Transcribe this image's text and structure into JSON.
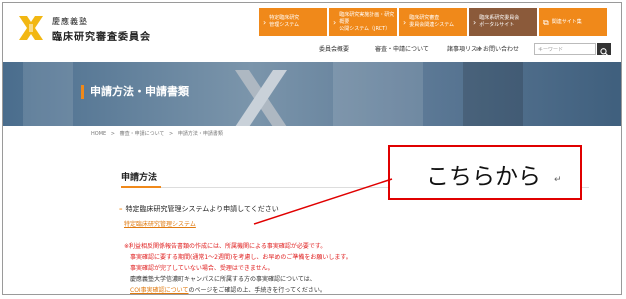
{
  "header": {
    "logo_line1": "慶應義塾",
    "logo_line2": "臨床研究審査委員会"
  },
  "topnav": [
    {
      "line1": "特定臨床研究",
      "line2": "管理システム",
      "style": "orange"
    },
    {
      "line1": "臨床研究実施計画・研究概要",
      "line2": "公開システム（jRCT）",
      "style": "orange"
    },
    {
      "line1": "臨床研究審査",
      "line2": "委員会関連システム",
      "style": "orange"
    },
    {
      "line1": "臨床系研究委員会",
      "line2": "ポータルサイト",
      "style": "brown"
    },
    {
      "line1": "関連サイト集",
      "line2": "",
      "style": "orange"
    }
  ],
  "subnav": {
    "overview": "委員会概要",
    "review": "審査・申請について",
    "checklist": "諸事項リスト",
    "contact": "お問い合わせ"
  },
  "search": {
    "placeholder": "キーワード"
  },
  "banner": {
    "title": "申請方法・申請書類"
  },
  "breadcrumb": [
    "HOME",
    "審査・申請について",
    "申請方法・申請書類"
  ],
  "breadcrumb_sep": ">",
  "content": {
    "heading": "申請方法",
    "subheading": "特定臨床研究管理システムより申請してください",
    "system_link": "特定臨床研究管理システム",
    "notes": {
      "line1": "※利益相反関係報告書類の作成には、所属機関による事実確認が必要です。",
      "line2": "事実確認に要する期間(通常1～2週間)を考慮し、お早めのご準備をお願いします。",
      "line3": "事実確認が完了していない場合、受理はできません。",
      "line4": "慶應義塾大学信濃町キャンパスに所属する方の事実確認については、",
      "line5_link": "COI事実確認について",
      "line5_rest": "のページをご確認の上、手続きを行ってください。"
    }
  },
  "callout": {
    "text": "こちらから",
    "mark": "↵"
  },
  "colors": {
    "accent": "#f0891a",
    "brown": "#8b5a3a",
    "callout_border": "#e00000"
  }
}
